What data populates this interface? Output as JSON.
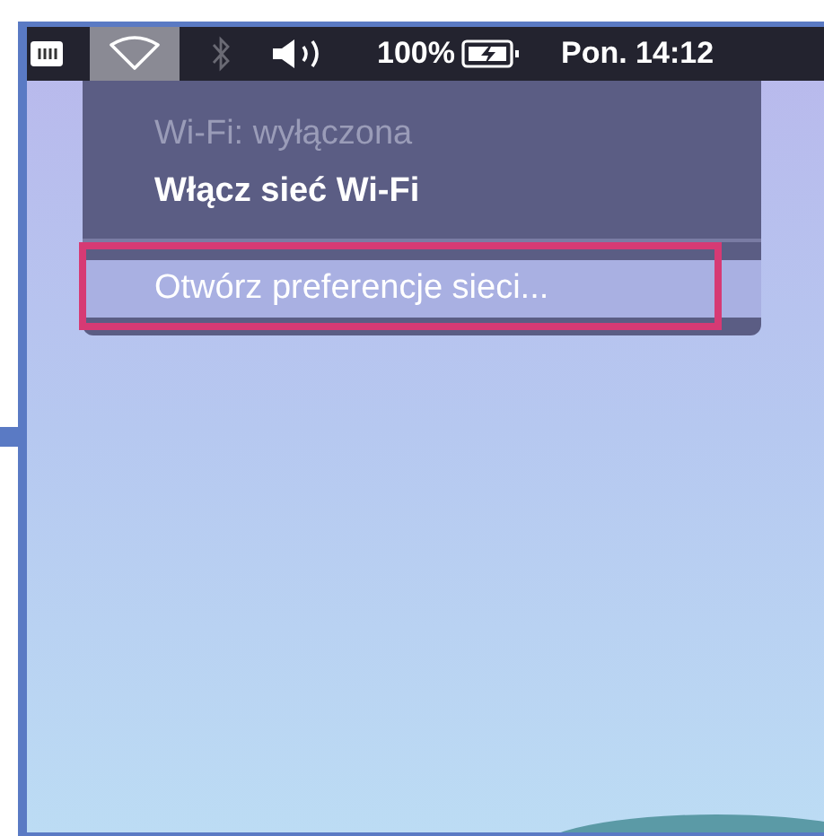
{
  "menu_bar": {
    "wifi": {
      "selected": true
    },
    "bluetooth": {
      "disabled": true
    },
    "battery_percent": "100%",
    "clock": "Pon. 14:12"
  },
  "menu": {
    "groups": [
      {
        "items": [
          {
            "label": "Wi-Fi: wyłączona",
            "disabled": true,
            "selected": false
          },
          {
            "label": "Włącz sieć Wi-Fi",
            "disabled": false,
            "selected": false
          }
        ]
      },
      {
        "items": [
          {
            "label": "Otwórz preferencje sieci...",
            "disabled": false,
            "selected": true
          }
        ]
      }
    ]
  },
  "annotation": {
    "kind": "highlight-box",
    "color": "#d63a74"
  }
}
